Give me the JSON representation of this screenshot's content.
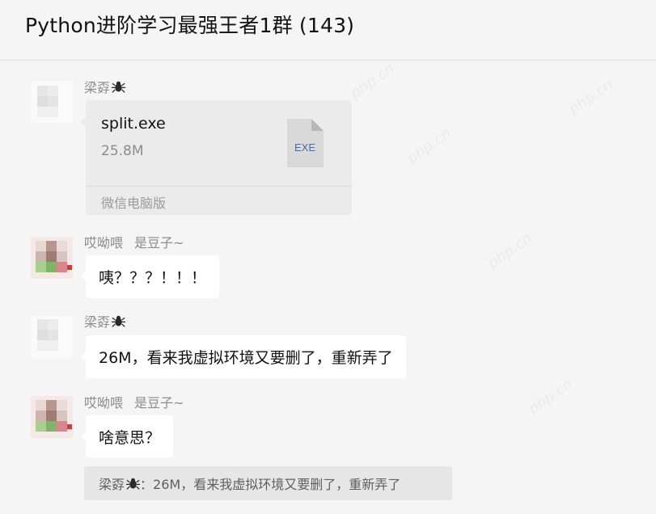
{
  "header": {
    "title": "Python进阶学习最强王者1群 (143)"
  },
  "messages": [
    {
      "sender": "梁孬",
      "file": {
        "name": "split.exe",
        "size": "25.8M",
        "type_label": "EXE",
        "source": "微信电脑版"
      }
    },
    {
      "sender": "哎呦喂",
      "sender_group_nick": "是豆子~",
      "text": "咦？？？！！！"
    },
    {
      "sender": "梁孬",
      "text": "26M，看来我虚拟环境又要删了，重新弄了"
    },
    {
      "sender": "哎呦喂",
      "sender_group_nick": "是豆子~",
      "text": "啥意思？",
      "quote": {
        "sender": "梁孬",
        "separator": "：",
        "text": "26M，看来我虚拟环境又要删了，重新弄了"
      }
    }
  ],
  "watermark": "php.cn",
  "colors": {
    "background": "#f5f5f5",
    "bubble": "#ffffff",
    "file_card": "#ebebeb",
    "quote": "#e6e6e6",
    "muted_text": "#8c8c8c"
  },
  "icons": {
    "sender_badge": "spider-icon",
    "file": "exe-file-icon"
  }
}
